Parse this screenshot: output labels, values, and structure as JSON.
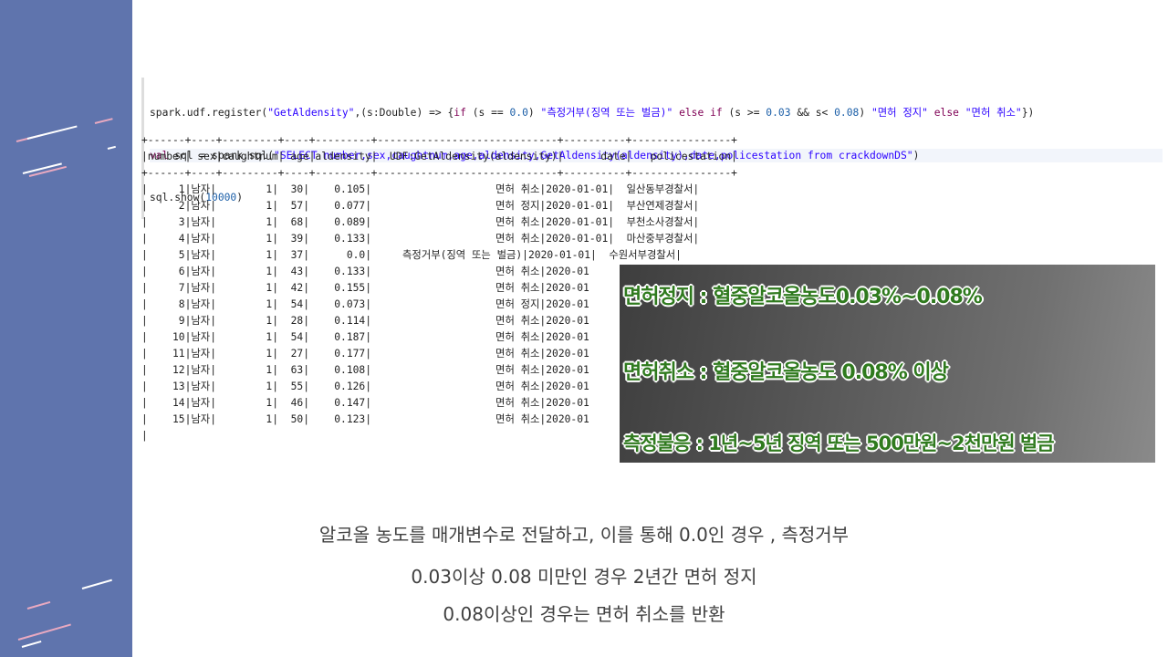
{
  "colors": {
    "sidebar": "#5f74ad",
    "overlay_text": "#2f7a1e"
  },
  "code": {
    "line1": [
      {
        "t": "spark.udf.register(",
        "c": "pl"
      },
      {
        "t": "\"GetAldensity\"",
        "c": "str"
      },
      {
        "t": ",(s:Double) => {",
        "c": "pl"
      },
      {
        "t": "if",
        "c": "kw"
      },
      {
        "t": " (s == ",
        "c": "pl"
      },
      {
        "t": "0.0",
        "c": "num"
      },
      {
        "t": ") ",
        "c": "pl"
      },
      {
        "t": "\"측정거부(징역 또는 벌금)\"",
        "c": "str"
      },
      {
        "t": " else if",
        "c": "kw"
      },
      {
        "t": " (s >= ",
        "c": "pl"
      },
      {
        "t": "0.03",
        "c": "num"
      },
      {
        "t": " && s< ",
        "c": "pl"
      },
      {
        "t": "0.08",
        "c": "num"
      },
      {
        "t": ") ",
        "c": "pl"
      },
      {
        "t": "\"면허 정지\"",
        "c": "str"
      },
      {
        "t": " else ",
        "c": "kw"
      },
      {
        "t": "\"면허 취소\"",
        "c": "str"
      },
      {
        "t": "})",
        "c": "pl"
      }
    ],
    "line2": [
      {
        "t": "val",
        "c": "kw"
      },
      {
        "t": " sql = spark.sql(",
        "c": "pl"
      },
      {
        "t": "\"SELECT number,sex,caughtnum,age,aldensity,GetAldensity(aldensity),date,policestation from crackdownDS\"",
        "c": "str"
      },
      {
        "t": ")",
        "c": "pl"
      }
    ],
    "line3": [
      {
        "t": "sql.show(",
        "c": "pl"
      },
      {
        "t": "10000",
        "c": "num"
      },
      {
        "t": ")",
        "c": "pl"
      }
    ]
  },
  "table": {
    "headers": [
      "number",
      "sex",
      "caughtnum",
      "age",
      "aldensity",
      "UDF:GetAldensity(aldensity)",
      "date",
      "policestation"
    ],
    "rows": [
      [
        "1",
        "남자",
        "1",
        "30",
        "0.105",
        "면허 취소",
        "2020-01-01",
        "일산동부경찰서"
      ],
      [
        "2",
        "남자",
        "1",
        "57",
        "0.077",
        "면허 정지",
        "2020-01-01",
        "부산연제경찰서"
      ],
      [
        "3",
        "남자",
        "1",
        "68",
        "0.089",
        "면허 취소",
        "2020-01-01",
        "부천소사경찰서"
      ],
      [
        "4",
        "남자",
        "1",
        "39",
        "0.133",
        "면허 취소",
        "2020-01-01",
        "마산중부경찰서"
      ],
      [
        "5",
        "남자",
        "1",
        "37",
        "0.0",
        "측정거부(징역 또는 벌금)",
        "2020-01-01",
        "수원서부경찰서"
      ],
      [
        "6",
        "남자",
        "1",
        "43",
        "0.133",
        "면허 취소",
        "2020-01",
        ""
      ],
      [
        "7",
        "남자",
        "1",
        "42",
        "0.155",
        "면허 취소",
        "2020-01",
        ""
      ],
      [
        "8",
        "남자",
        "1",
        "54",
        "0.073",
        "면허 정지",
        "2020-01",
        ""
      ],
      [
        "9",
        "남자",
        "1",
        "28",
        "0.114",
        "면허 취소",
        "2020-01",
        ""
      ],
      [
        "10",
        "남자",
        "1",
        "54",
        "0.187",
        "면허 취소",
        "2020-01",
        ""
      ],
      [
        "11",
        "남자",
        "1",
        "27",
        "0.177",
        "면허 취소",
        "2020-01",
        ""
      ],
      [
        "12",
        "남자",
        "1",
        "63",
        "0.108",
        "면허 취소",
        "2020-01",
        ""
      ],
      [
        "13",
        "남자",
        "1",
        "55",
        "0.126",
        "면허 취소",
        "2020-01",
        ""
      ],
      [
        "14",
        "남자",
        "1",
        "46",
        "0.147",
        "면허 취소",
        "2020-01",
        ""
      ],
      [
        "15",
        "남자",
        "1",
        "50",
        "0.123",
        "면허 취소",
        "2020-01",
        ""
      ]
    ]
  },
  "overlay": {
    "line1": "면허정지 : 혈중알코올농도0.03%~0.08%",
    "line2": "면허취소 : 혈중알코올농도 0.08% 이상",
    "line3": "측정불응 : 1년~5년 징역 또는 500만원~2천만원 벌금"
  },
  "caption": {
    "line1": "알코올 농도를 매개변수로 전달하고, 이를 통해 0.0인 경우 , 측정거부",
    "line2": "0.03이상 0.08 미만인 경우 2년간 면허 정지",
    "line3": "0.08이상인 경우는 면허 취소를 반환"
  }
}
